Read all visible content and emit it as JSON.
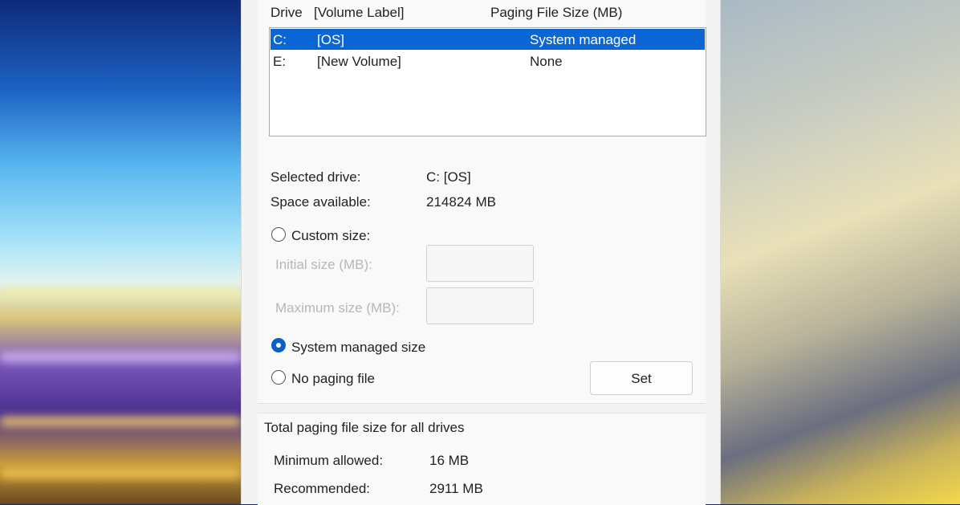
{
  "columns": {
    "drive": "Drive",
    "volume_label": "[Volume Label]",
    "paging_size": "Paging File Size (MB)"
  },
  "drives": [
    {
      "drive": "C:",
      "label": "[OS]",
      "size": "System managed",
      "selected": true
    },
    {
      "drive": "E:",
      "label": "[New Volume]",
      "size": "None",
      "selected": false
    }
  ],
  "selected_drive": {
    "label": "Selected drive:",
    "value": "C:  [OS]"
  },
  "space_available": {
    "label": "Space available:",
    "value": "214824 MB"
  },
  "options": {
    "custom_size": "Custom size:",
    "initial_size": "Initial size (MB):",
    "maximum_size": "Maximum size (MB):",
    "system_managed": "System managed size",
    "no_paging": "No paging file"
  },
  "set_button": "Set",
  "totals": {
    "heading": "Total paging file size for all drives",
    "minimum_label": "Minimum allowed:",
    "minimum_value": "16 MB",
    "recommended_label": "Recommended:",
    "recommended_value": "2911 MB"
  },
  "colors": {
    "accent": "#0a66d4",
    "selection": "#0a66d4"
  }
}
